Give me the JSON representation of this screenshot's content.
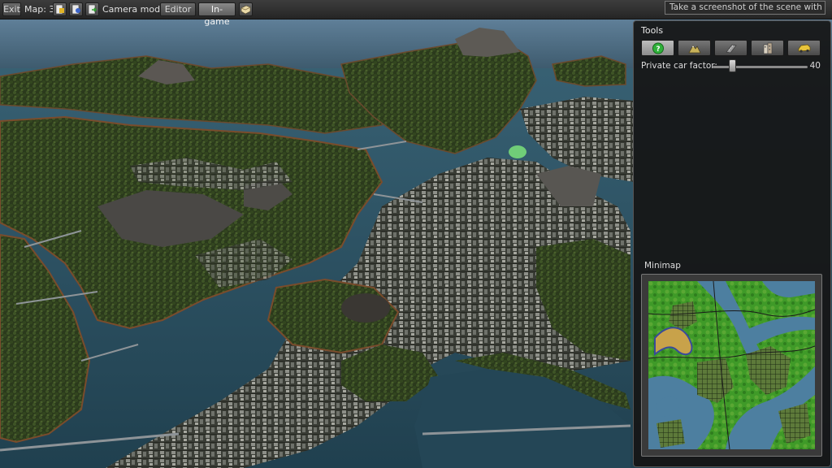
{
  "toolbar": {
    "exit_label": "Exit",
    "map_label": "Map: 3",
    "camera_mode_label": "Camera mode:",
    "editor_label": "Editor",
    "ingame_label": "In-game",
    "screenshot_tooltip": "Take a screenshot of the scene with GUI",
    "icons": [
      "map-previous-icon",
      "map-info-icon",
      "map-next-icon",
      "screenshot-icon"
    ]
  },
  "tools_panel": {
    "title": "Tools",
    "tools": [
      {
        "icon": "help-icon",
        "selected": true
      },
      {
        "icon": "terrain-icon",
        "selected": false
      },
      {
        "icon": "road-icon",
        "selected": false
      },
      {
        "icon": "building-icon",
        "selected": false
      },
      {
        "icon": "vehicle-icon",
        "selected": false
      }
    ],
    "car_factor_label": "Private car factor:",
    "car_factor_value": "40",
    "minimap_title": "Minimap"
  },
  "colors": {
    "water": "#2f5566",
    "land_dark": "#232a1a",
    "forest": "#384a22",
    "minimap_green": "#3c9a2a",
    "minimap_water": "#4d7fa0",
    "selected_tool": "#2fb13a"
  }
}
